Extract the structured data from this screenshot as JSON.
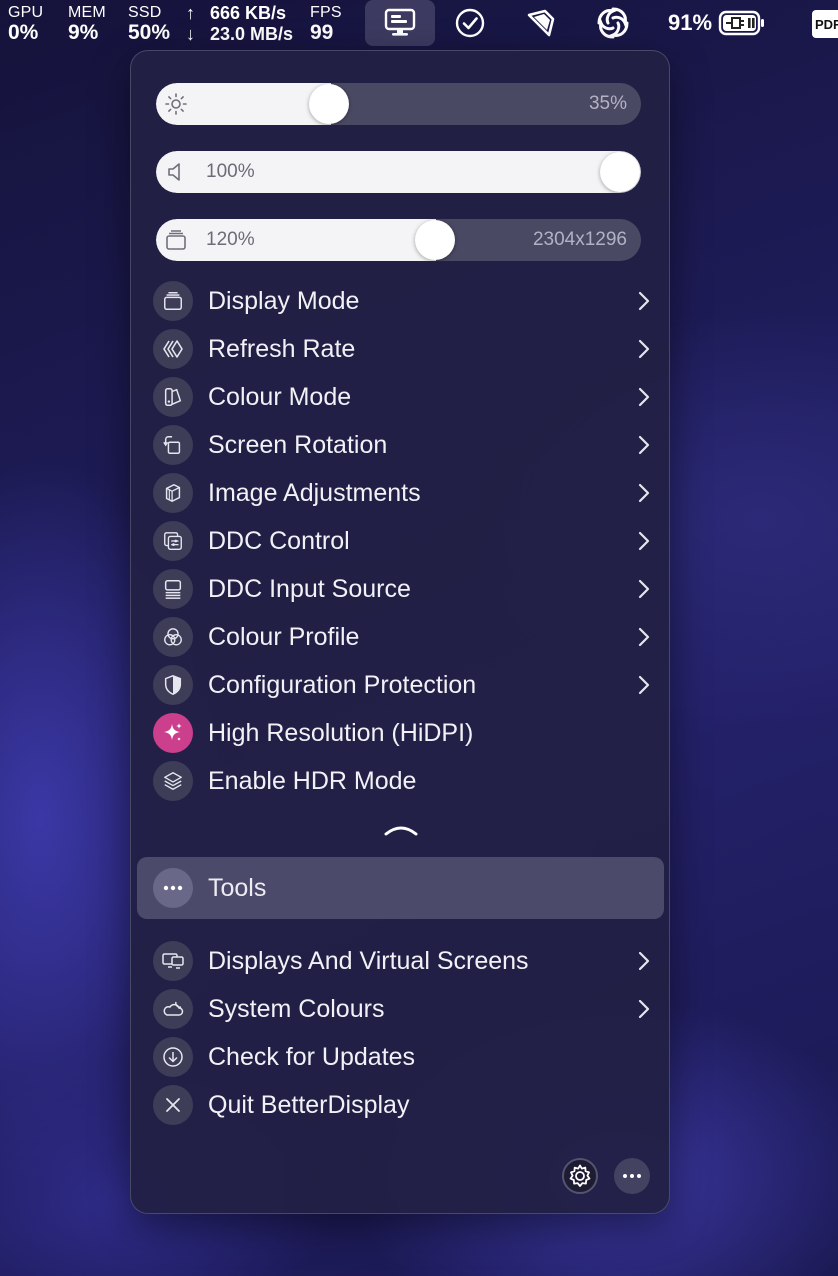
{
  "menubar": {
    "gpu": {
      "label": "GPU",
      "value": "0%"
    },
    "mem": {
      "label": "MEM",
      "value": "9%"
    },
    "ssd": {
      "label": "SSD",
      "value": "50%"
    },
    "net": {
      "up": "666 KB/s",
      "down": "23.0 MB/s"
    },
    "fps": {
      "label": "FPS",
      "value": "99"
    },
    "battery": "91%",
    "pdf": "PDF"
  },
  "sliders": {
    "brightness": {
      "value_text": "35%",
      "level": 0.35
    },
    "volume": {
      "value_text": "100%",
      "level": 1.0
    },
    "resolution": {
      "value_text": "120%",
      "resolution": "2304x1296",
      "level": 0.57
    }
  },
  "menu": {
    "items": [
      {
        "label": "Display Mode",
        "icon": "display-mode-icon",
        "submenu": true
      },
      {
        "label": "Refresh Rate",
        "icon": "refresh-rate-icon",
        "submenu": true
      },
      {
        "label": "Colour Mode",
        "icon": "colour-mode-icon",
        "submenu": true
      },
      {
        "label": "Screen Rotation",
        "icon": "rotation-icon",
        "submenu": true
      },
      {
        "label": "Image Adjustments",
        "icon": "image-adjustments-icon",
        "submenu": true
      },
      {
        "label": "DDC Control",
        "icon": "ddc-control-icon",
        "submenu": true
      },
      {
        "label": "DDC Input Source",
        "icon": "input-source-icon",
        "submenu": true
      },
      {
        "label": "Colour Profile",
        "icon": "colour-profile-icon",
        "submenu": true
      },
      {
        "label": "Configuration Protection",
        "icon": "shield-icon",
        "submenu": true
      },
      {
        "label": "High Resolution (HiDPI)",
        "icon": "sparkles-icon",
        "submenu": false
      },
      {
        "label": "Enable HDR Mode",
        "icon": "layers-icon",
        "submenu": false
      }
    ],
    "tools": {
      "label": "Tools"
    },
    "bottom_items": [
      {
        "label": "Displays And Virtual Screens",
        "icon": "displays-icon",
        "submenu": true
      },
      {
        "label": "System Colours",
        "icon": "weather-icon",
        "submenu": true
      },
      {
        "label": "Check for Updates",
        "icon": "download-circle-icon",
        "submenu": false
      },
      {
        "label": "Quit BetterDisplay",
        "icon": "close-icon",
        "submenu": false
      }
    ]
  }
}
